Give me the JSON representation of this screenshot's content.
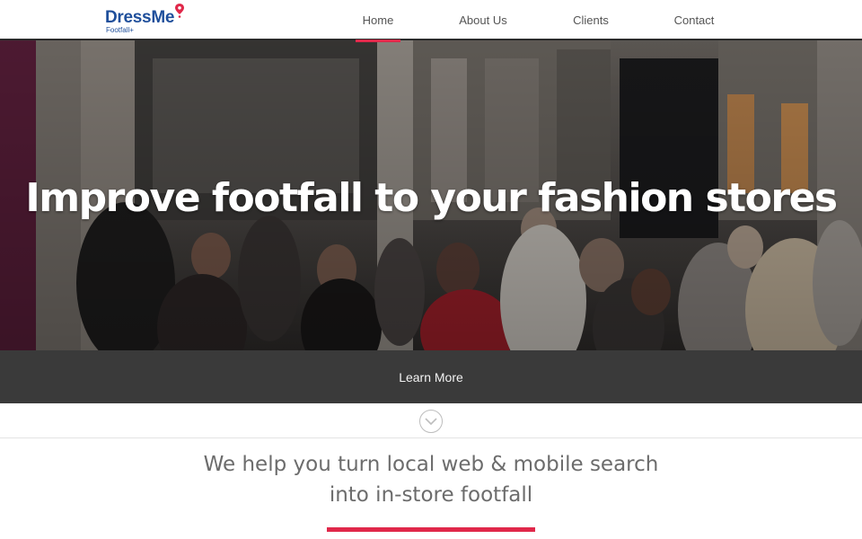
{
  "brand": {
    "name": "DressMe",
    "sub": "Footfall+"
  },
  "nav": {
    "home": "Home",
    "about": "About Us",
    "clients": "Clients",
    "contact": "Contact"
  },
  "hero": {
    "title": "Improve footfall to your fashion stores",
    "button": "Learn More"
  },
  "intro": {
    "line1": "We help you turn local web & mobile search",
    "line2": "into in-store footfall"
  },
  "colors": {
    "accent": "#e0284a",
    "brand": "#1f4f9b",
    "dark_bar": "#3a3a3a"
  },
  "icons": {
    "scroll": "chevron-down-icon",
    "logo_pin": "map-pin-icon"
  }
}
